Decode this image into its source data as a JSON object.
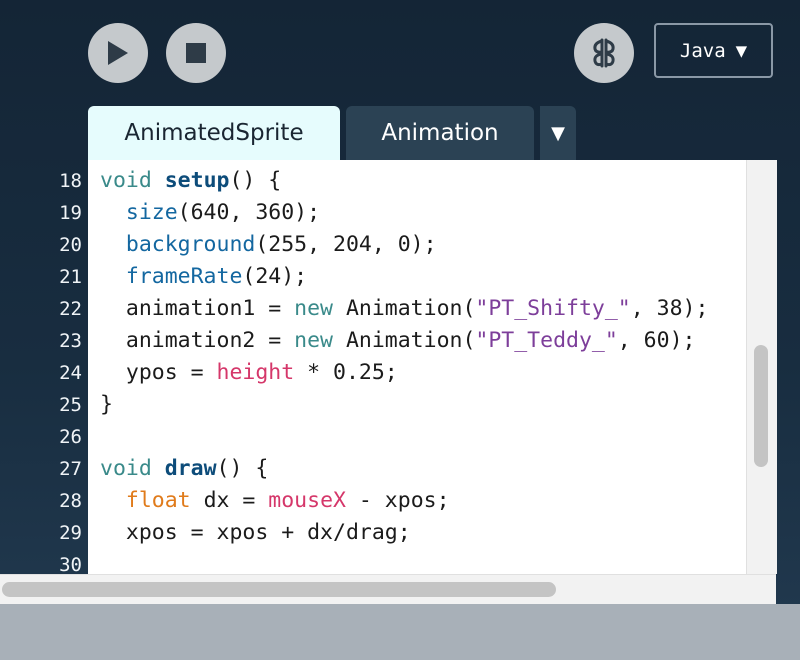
{
  "toolbar": {
    "run_icon": "play-icon",
    "stop_icon": "stop-icon",
    "debug_icon": "butterfly-icon",
    "mode_label": "Java",
    "mode_arrow": "▼"
  },
  "tabs": [
    {
      "label": "AnimatedSprite",
      "active": true
    },
    {
      "label": "Animation",
      "active": false
    }
  ],
  "tab_menu_label": "▼",
  "editor": {
    "line_numbers": [
      "18",
      "19",
      "20",
      "21",
      "22",
      "23",
      "24",
      "25",
      "26",
      "27",
      "28",
      "29",
      "30"
    ],
    "lines": [
      [
        {
          "t": "void ",
          "c": "kw"
        },
        {
          "t": "setup",
          "c": "fn-bold"
        },
        {
          "t": "() {",
          "c": ""
        }
      ],
      [
        {
          "t": "  ",
          "c": ""
        },
        {
          "t": "size",
          "c": "fn"
        },
        {
          "t": "(640, 360);",
          "c": ""
        }
      ],
      [
        {
          "t": "  ",
          "c": ""
        },
        {
          "t": "background",
          "c": "fn"
        },
        {
          "t": "(255, 204, 0);",
          "c": ""
        }
      ],
      [
        {
          "t": "  ",
          "c": ""
        },
        {
          "t": "frameRate",
          "c": "fn"
        },
        {
          "t": "(24);",
          "c": ""
        }
      ],
      [
        {
          "t": "  animation1 = ",
          "c": ""
        },
        {
          "t": "new",
          "c": "kw"
        },
        {
          "t": " Animation(",
          "c": ""
        },
        {
          "t": "\"PT_Shifty_\"",
          "c": "str"
        },
        {
          "t": ", 38);",
          "c": ""
        }
      ],
      [
        {
          "t": "  animation2 = ",
          "c": ""
        },
        {
          "t": "new",
          "c": "kw"
        },
        {
          "t": " Animation(",
          "c": ""
        },
        {
          "t": "\"PT_Teddy_\"",
          "c": "str"
        },
        {
          "t": ", 60);",
          "c": ""
        }
      ],
      [
        {
          "t": "  ypos = ",
          "c": ""
        },
        {
          "t": "height",
          "c": "var"
        },
        {
          "t": " * 0.25;",
          "c": ""
        }
      ],
      [
        {
          "t": "}",
          "c": ""
        }
      ],
      [
        {
          "t": "",
          "c": ""
        }
      ],
      [
        {
          "t": "void ",
          "c": "kw"
        },
        {
          "t": "draw",
          "c": "fn-bold"
        },
        {
          "t": "() {",
          "c": ""
        }
      ],
      [
        {
          "t": "  ",
          "c": ""
        },
        {
          "t": "float",
          "c": "type"
        },
        {
          "t": " dx = ",
          "c": ""
        },
        {
          "t": "mouseX",
          "c": "var"
        },
        {
          "t": " - xpos;",
          "c": ""
        }
      ],
      [
        {
          "t": "  xpos = xpos + dx/drag;",
          "c": ""
        }
      ],
      [
        {
          "t": "",
          "c": ""
        }
      ]
    ]
  },
  "colors": {
    "active_tab_bg": "#e6fcfd",
    "inactive_tab_bg": "#2b4254",
    "keyword": "#3a8a8a",
    "function": "#1367a0",
    "string": "#7d3e9a",
    "variable": "#d5376a",
    "type": "#e07b1b"
  }
}
